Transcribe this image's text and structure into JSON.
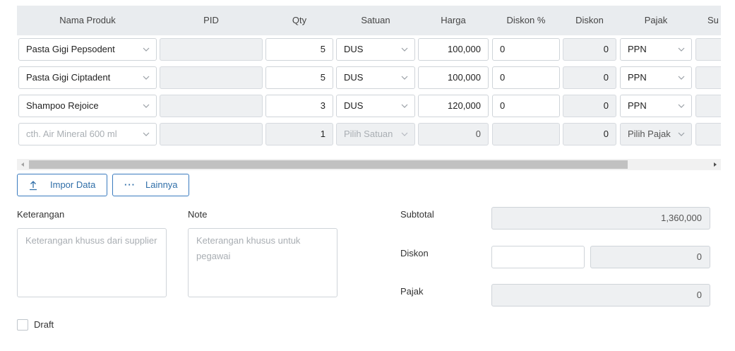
{
  "table": {
    "headers": {
      "nama_produk": "Nama Produk",
      "pid": "PID",
      "qty": "Qty",
      "satuan": "Satuan",
      "harga": "Harga",
      "diskon_pct": "Diskon %",
      "diskon": "Diskon",
      "pajak": "Pajak",
      "subtotal": "Su"
    },
    "rows": [
      {
        "nama": "Pasta Gigi Pepsodent",
        "pid": "",
        "qty": "5",
        "satuan": "DUS",
        "harga": "100,000",
        "diskon_pct": "0",
        "diskon": "0",
        "pajak": "PPN"
      },
      {
        "nama": "Pasta Gigi Ciptadent",
        "pid": "",
        "qty": "5",
        "satuan": "DUS",
        "harga": "100,000",
        "diskon_pct": "0",
        "diskon": "0",
        "pajak": "PPN"
      },
      {
        "nama": "Shampoo Rejoice",
        "pid": "",
        "qty": "3",
        "satuan": "DUS",
        "harga": "120,000",
        "diskon_pct": "0",
        "diskon": "0",
        "pajak": "PPN"
      }
    ],
    "new_row": {
      "nama_placeholder": "cth. Air Mineral 600 ml",
      "qty": "1",
      "satuan_placeholder": "Pilih Satuan",
      "harga": "0",
      "diskon": "0",
      "pajak_placeholder": "Pilih Pajak"
    }
  },
  "actions": {
    "import_label": "Impor Data",
    "more_label": "Lainnya"
  },
  "form": {
    "keterangan_label": "Keterangan",
    "keterangan_placeholder": "Keterangan khusus dari supplier",
    "note_label": "Note",
    "note_placeholder": "Keterangan khusus untuk pegawai",
    "draft_label": "Draft"
  },
  "summary": {
    "subtotal_label": "Subtotal",
    "subtotal_value": "1,360,000",
    "diskon_label": "Diskon",
    "diskon_input": "",
    "diskon_value": "0",
    "pajak_label": "Pajak",
    "pajak_value": "0"
  },
  "colors": {
    "accent": "#2f6ea8",
    "header_bg": "#e9ecef",
    "disabled_bg": "#eef0f2"
  }
}
